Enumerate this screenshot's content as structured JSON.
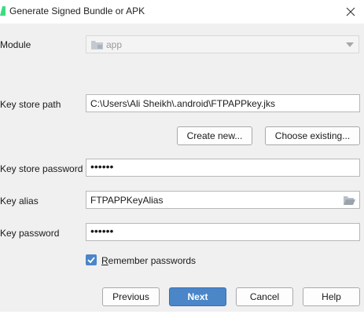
{
  "window": {
    "title": "Generate Signed Bundle or APK"
  },
  "module": {
    "label": "Module",
    "value": "app"
  },
  "keystore": {
    "path_label": "Key store path",
    "path_value": "C:\\Users\\Ali Sheikh\\.android\\FTPAPPkey.jks",
    "create_new_label": "Create new...",
    "choose_existing_label": "Choose existing...",
    "password_label": "Key store password",
    "password_value": "••••••"
  },
  "key": {
    "alias_label": "Key alias",
    "alias_value": "FTPAPPKeyAlias",
    "password_label": "Key password",
    "password_value": "••••••"
  },
  "remember": {
    "mnemonic": "R",
    "rest": "emember passwords",
    "checked": true
  },
  "buttons": {
    "previous": "Previous",
    "next": "Next",
    "cancel": "Cancel",
    "help": "Help"
  },
  "colors": {
    "accent": "#4a86c8",
    "window_bg": "#f0f0f0"
  }
}
